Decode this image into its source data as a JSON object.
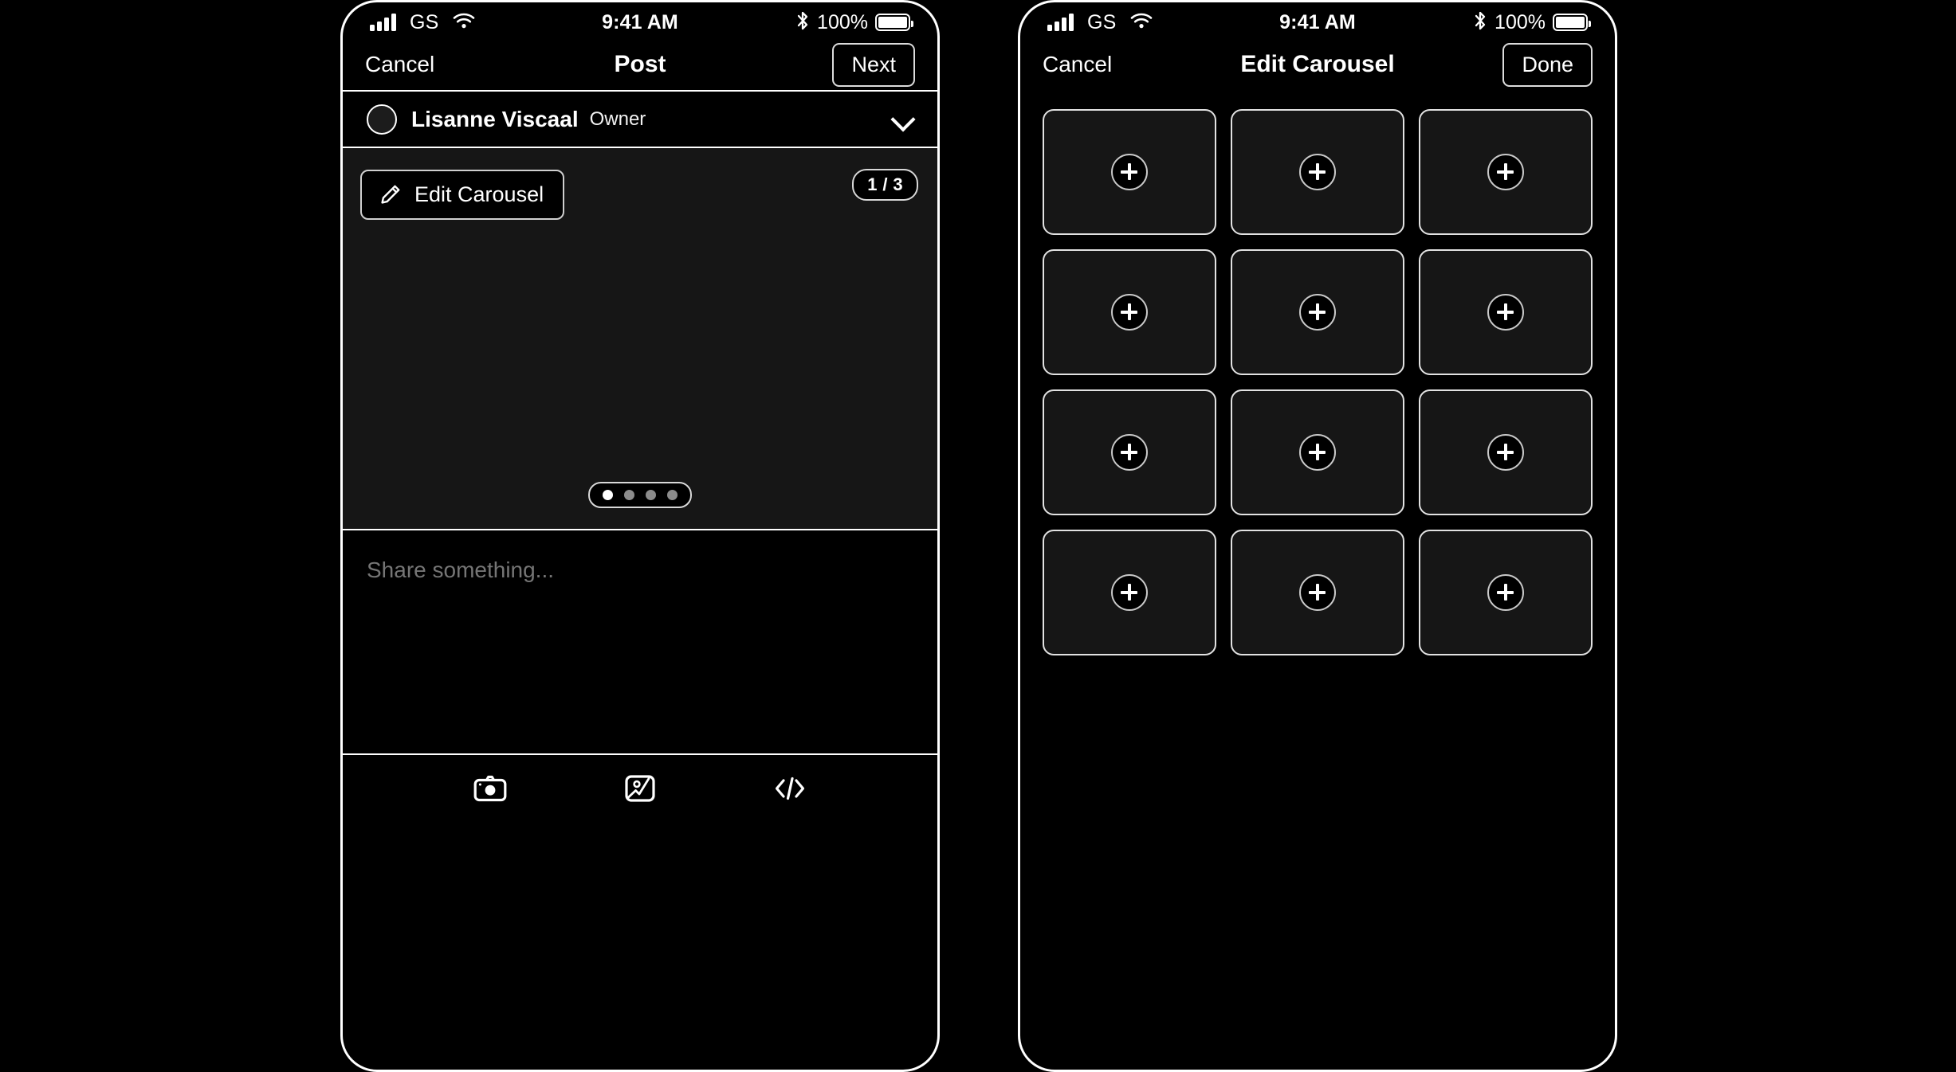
{
  "status_bar": {
    "carrier": "GS",
    "time": "9:41 AM",
    "battery_percent": "100%",
    "signal_icon": "cellular-signal-icon",
    "wifi_icon": "wifi-icon",
    "bluetooth_icon": "bluetooth-icon",
    "battery_icon": "battery-full-icon"
  },
  "post_screen": {
    "nav": {
      "cancel_label": "Cancel",
      "title": "Post",
      "action_label": "Next"
    },
    "user": {
      "name": "Lisanne Viscaal",
      "role": "Owner",
      "avatar_icon": "avatar-placeholder-icon",
      "chevron_icon": "chevron-down-icon"
    },
    "media": {
      "edit_button_label": "Edit Carousel",
      "pencil_icon": "pencil-icon",
      "page_badge": "1 / 3",
      "dots_total": 4,
      "dots_active_index": 0
    },
    "composer": {
      "placeholder": "Share something...",
      "value": ""
    },
    "toolbar": {
      "items": [
        {
          "icon": "camera-icon",
          "name": "camera-button"
        },
        {
          "icon": "photo-icon",
          "name": "photo-library-button"
        },
        {
          "icon": "code-icon",
          "name": "embed-code-button"
        }
      ]
    }
  },
  "carousel_screen": {
    "nav": {
      "cancel_label": "Cancel",
      "title": "Edit Carousel",
      "action_label": "Done"
    },
    "grid": {
      "rows": 4,
      "columns": 3,
      "tile_count": 12,
      "tile_icon": "plus-circle-icon",
      "tile_state": "empty"
    }
  },
  "colors": {
    "background": "#000000",
    "tile_fill": "#161616",
    "media_fill": "#161616",
    "border": "#ffffff",
    "muted_border": "#cfcfcf",
    "text": "#ffffff",
    "dot_inactive": "#8c8c8c"
  }
}
